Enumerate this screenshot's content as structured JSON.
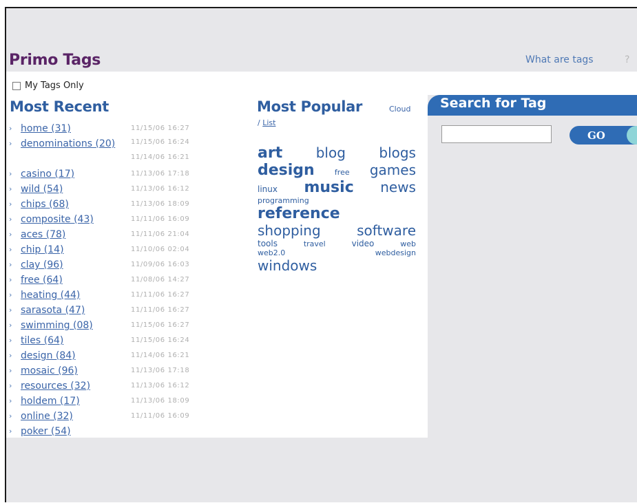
{
  "header": {
    "title": "Primo Tags",
    "what_link": "What are tags",
    "help": "?"
  },
  "filter": {
    "my_tags_label": "My Tags Only"
  },
  "recent": {
    "title": "Most Recent",
    "items": [
      {
        "label": "home (31)",
        "date": "11/15/06 16:27"
      },
      {
        "label": "denominations (20)",
        "date": "11/15/06 16:24",
        "date2": "11/14/06 16:21"
      },
      {
        "label": "casino (17)",
        "date": "11/13/06 17:18"
      },
      {
        "label": "wild (54)",
        "date": "11/13/06 16:12"
      },
      {
        "label": "chips (68)",
        "date": "11/13/06 18:09"
      },
      {
        "label": "composite (43)",
        "date": "11/11/06 16:09"
      },
      {
        "label": "aces (78)",
        "date": "11/11/06 21:04"
      },
      {
        "label": "chip (14)",
        "date": "11/10/06 02:04"
      },
      {
        "label": "clay (96)",
        "date": "11/09/06 16:03"
      },
      {
        "label": "free (64)",
        "date": "11/08/06 14:27"
      },
      {
        "label": "heating (44)",
        "date": "11/11/06 16:27"
      },
      {
        "label": "sarasota (47)",
        "date": "11/11/06 16:27"
      },
      {
        "label": "swimming (08)",
        "date": "11/15/06 16:27"
      },
      {
        "label": "tiles (64)",
        "date": "11/15/06 16:24"
      },
      {
        "label": "design (84)",
        "date": "11/14/06 16:21"
      },
      {
        "label": "mosaic (96)",
        "date": "11/13/06 17:18"
      },
      {
        "label": "resources (32)",
        "date": "11/13/06 16:12"
      },
      {
        "label": "holdem (17)",
        "date": "11/13/06 18:09"
      },
      {
        "label": "online (32)",
        "date": "11/11/06 16:09"
      },
      {
        "label": "poker (54)",
        "date": ""
      }
    ]
  },
  "popular": {
    "title": "Most Popular",
    "view_cloud": "Cloud",
    "separator": "/",
    "view_list": "List",
    "cloud_rows": [
      [
        {
          "t": "art",
          "s": "xl"
        },
        {
          "t": "blog",
          "s": "lg"
        },
        {
          "t": "blogs",
          "s": "lg"
        }
      ],
      [
        {
          "t": "design",
          "s": "xl"
        },
        {
          "t": "free",
          "s": "sm"
        },
        {
          "t": "games",
          "s": "lg"
        }
      ],
      [
        {
          "t": "linux",
          "s": "md"
        },
        {
          "t": "music",
          "s": "xl"
        },
        {
          "t": "news",
          "s": "lg"
        }
      ],
      [
        {
          "t": "programming",
          "s": "sm"
        }
      ],
      [
        {
          "t": "reference",
          "s": "xl"
        }
      ],
      [
        {
          "t": "shopping",
          "s": "lg"
        },
        {
          "t": "software",
          "s": "lg"
        }
      ],
      [
        {
          "t": "tools",
          "s": "md"
        },
        {
          "t": "travel",
          "s": "sm"
        },
        {
          "t": "video",
          "s": "md"
        },
        {
          "t": "web",
          "s": "sm"
        }
      ],
      [
        {
          "t": "web2.0",
          "s": "sm"
        },
        {
          "t": "webdesign",
          "s": "sm"
        }
      ],
      [
        {
          "t": "windows",
          "s": "lg"
        }
      ]
    ]
  },
  "search": {
    "title": "Search for Tag",
    "input_value": "",
    "go_label": "GO"
  },
  "colors": {
    "title_purple": "#5a2466",
    "link_blue": "#3a64a8",
    "panel_blue": "#2f6cb5",
    "date_gray": "#b0b0b0",
    "bg_gray": "#e7e7ea"
  }
}
